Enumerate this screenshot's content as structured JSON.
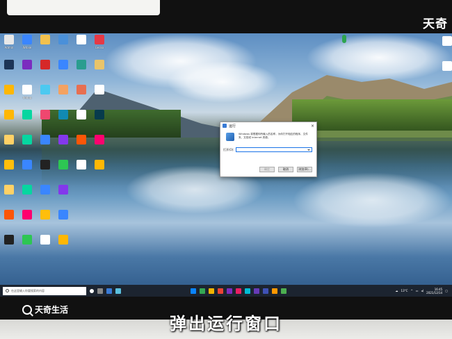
{
  "watermark": {
    "top": "天奇",
    "bottom": "天奇生活"
  },
  "subtitle": "弹出运行窗口",
  "desktop": {
    "icons": [
      {
        "label": "Admin",
        "color": "#e8e8e8"
      },
      {
        "label": "Whale",
        "color": "#3a86ff"
      },
      {
        "label": "",
        "color": "#f2c14e"
      },
      {
        "label": "",
        "color": "#4a90d9"
      },
      {
        "label": "",
        "color": "#ffffff"
      },
      {
        "label": "Gecko",
        "color": "#e63946"
      },
      {
        "label": "",
        "color": "#1d3557"
      },
      {
        "label": "",
        "color": "#7b2cbf"
      },
      {
        "label": "",
        "color": "#d62828"
      },
      {
        "label": "",
        "color": "#3a86ff"
      },
      {
        "label": "",
        "color": "#2a9d8f"
      },
      {
        "label": "",
        "color": "#e9c46a"
      },
      {
        "label": "",
        "color": "#ffb703"
      },
      {
        "label": "debug",
        "color": "#ffffff"
      },
      {
        "label": "",
        "color": "#4cc9f0"
      },
      {
        "label": "",
        "color": "#f4a261"
      },
      {
        "label": "",
        "color": "#e76f51"
      },
      {
        "label": "",
        "color": "#ffffff"
      },
      {
        "label": "",
        "color": "#ffb703"
      },
      {
        "label": "",
        "color": "#06d6a0"
      },
      {
        "label": "",
        "color": "#ef476f"
      },
      {
        "label": "",
        "color": "#118ab2"
      },
      {
        "label": "",
        "color": "#ffffff"
      },
      {
        "label": "",
        "color": "#073b4c"
      },
      {
        "label": "",
        "color": "#ffd166"
      },
      {
        "label": "",
        "color": "#06d6a0"
      },
      {
        "label": "",
        "color": "#3a86ff"
      },
      {
        "label": "",
        "color": "#8338ec"
      },
      {
        "label": "",
        "color": "#fb5607"
      },
      {
        "label": "",
        "color": "#ff006e"
      },
      {
        "label": "",
        "color": "#ffbe0b"
      },
      {
        "label": "",
        "color": "#3a86ff"
      },
      {
        "label": "",
        "color": "#222222"
      },
      {
        "label": "",
        "color": "#2dc653"
      },
      {
        "label": "",
        "color": "#ffffff"
      },
      {
        "label": "",
        "color": "#ffb703"
      }
    ]
  },
  "dialog": {
    "title": "运行",
    "close": "×",
    "description": "Windows 将根据你所输入的名称，为你打开相应的程序、文件夹、文档或 Internet 资源。",
    "open_label": "打开(O):",
    "input_value": "",
    "ok": "确定",
    "cancel": "取消",
    "browse": "浏览(B)..."
  },
  "taskbar": {
    "search_placeholder": "在这里输入你要搜索的内容",
    "weather": "13°C",
    "time": "16:45",
    "date": "2021/12/14"
  }
}
